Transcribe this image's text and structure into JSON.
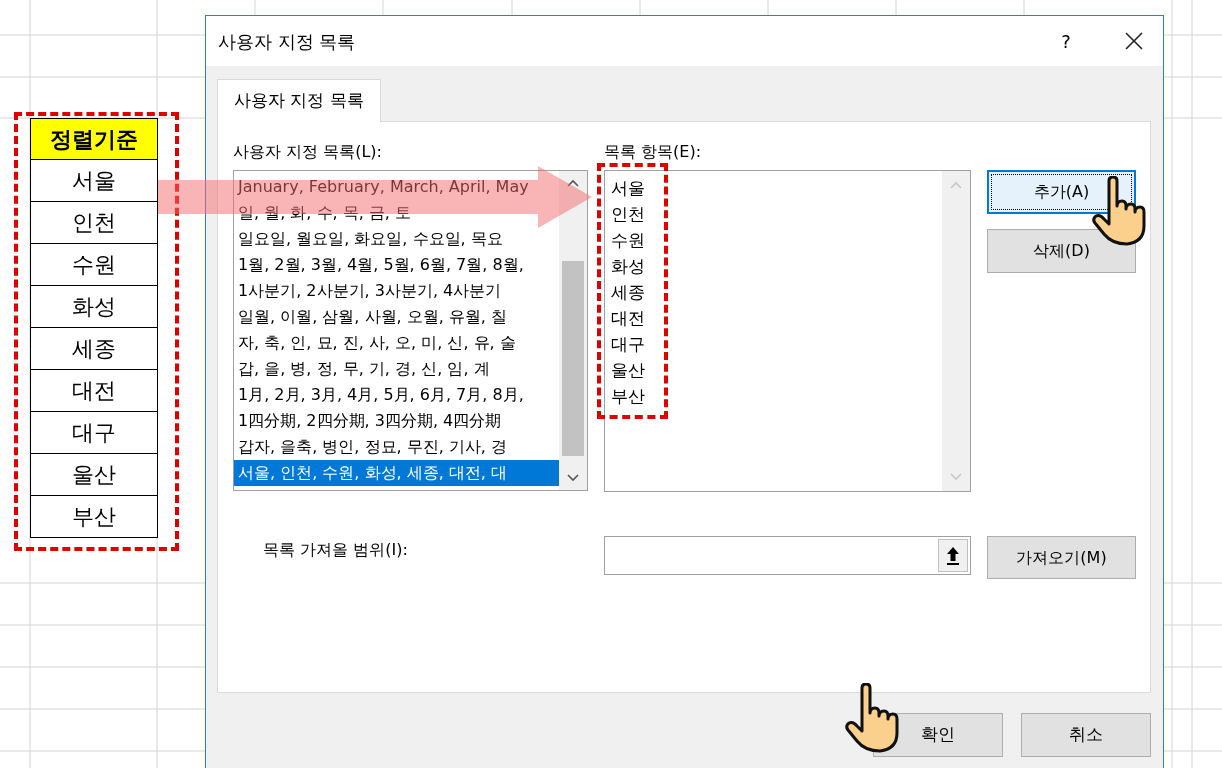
{
  "sheet": {
    "header": "정렬기준",
    "cells": [
      "서울",
      "인천",
      "수원",
      "화성",
      "세종",
      "대전",
      "대구",
      "울산",
      "부산"
    ]
  },
  "dialog": {
    "title": "사용자 지정 목록",
    "help": "?",
    "tabs": [
      {
        "label": "사용자 지정 목록",
        "selected": true
      }
    ],
    "lists_label": "사용자 지정 목록(L):",
    "lists": [
      {
        "text": "January, February, March, April, May",
        "selected": false
      },
      {
        "text": "일, 월, 화, 수, 목, 금, 토",
        "selected": false
      },
      {
        "text": "일요일, 월요일, 화요일, 수요일, 목요",
        "selected": false
      },
      {
        "text": "1월, 2월, 3월, 4월, 5월, 6월, 7월, 8월,",
        "selected": false
      },
      {
        "text": "1사분기, 2사분기, 3사분기, 4사분기",
        "selected": false
      },
      {
        "text": "일월, 이월, 삼월, 사월, 오월, 유월, 칠",
        "selected": false
      },
      {
        "text": "자, 축, 인, 묘, 진, 사, 오, 미, 신, 유, 술",
        "selected": false
      },
      {
        "text": "갑, 을, 병, 정, 무, 기, 경, 신, 임, 계",
        "selected": false
      },
      {
        "text": "1月, 2月, 3月, 4月, 5月, 6月, 7月, 8月,",
        "selected": false
      },
      {
        "text": "1四分期, 2四分期, 3四分期, 4四分期",
        "selected": false
      },
      {
        "text": "갑자, 을축, 병인, 정묘, 무진, 기사, 경",
        "selected": false
      },
      {
        "text": "서울, 인천, 수원, 화성, 세종, 대전, 대",
        "selected": true
      }
    ],
    "entries_label": "목록 항목(E):",
    "entries": [
      "서울",
      "인천",
      "수원",
      "화성",
      "세종",
      "대전",
      "대구",
      "울산",
      "부산"
    ],
    "side_buttons": [
      {
        "label": "추가(A)",
        "focused": true
      },
      {
        "label": "삭제(D)",
        "focused": false
      }
    ],
    "import_label": "목록 가져올 범위(I):",
    "import_button": "가져오기(M)",
    "footer_buttons": [
      "확인",
      "취소"
    ]
  }
}
